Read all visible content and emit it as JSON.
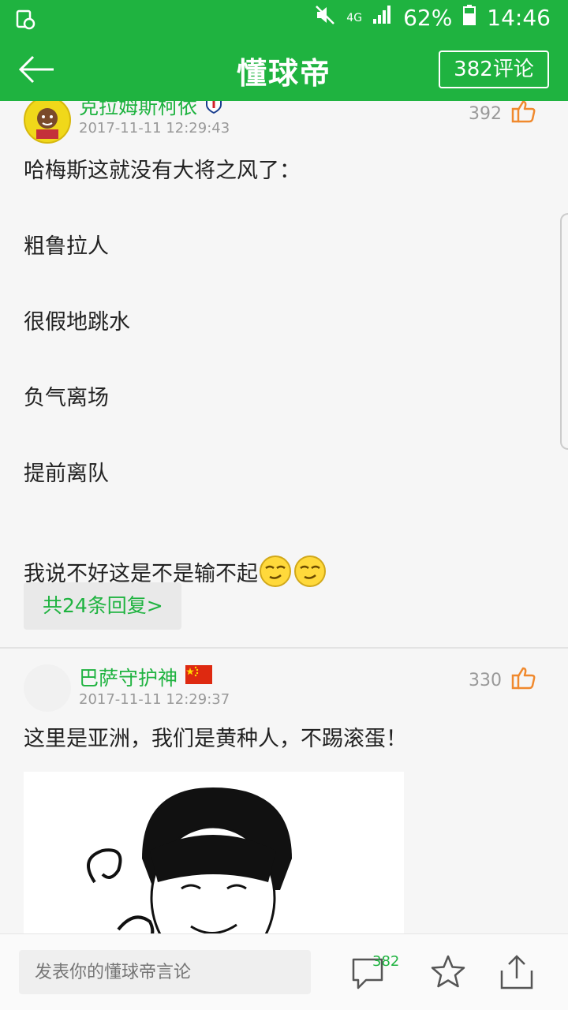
{
  "status_bar": {
    "battery": "62%",
    "time": "14:46",
    "network": "4G"
  },
  "app_bar": {
    "title": "懂球帝",
    "comment_count_label": "382评论"
  },
  "comments": [
    {
      "username": "克拉姆斯柯依",
      "time": "2017-11-11 12:29:43",
      "likes": "392",
      "lines": [
        "哈梅斯这就没有大将之风了：",
        "粗鲁拉人",
        "很假地跳水",
        "负气离场",
        "提前离队",
        "我说不好这是不是输不起"
      ],
      "replies_label": "共24条回复>"
    },
    {
      "username": "巴萨守护神",
      "time": "2017-11-11 12:29:37",
      "likes": "330",
      "text": "这里是亚洲，我们是黄种人，不踢滚蛋！"
    }
  ],
  "bottom_bar": {
    "input_placeholder": "发表你的懂球帝言论",
    "comment_count": "382"
  },
  "colors": {
    "brand": "#1fb340",
    "muted": "#999999",
    "like_icon": "#f0892d"
  }
}
